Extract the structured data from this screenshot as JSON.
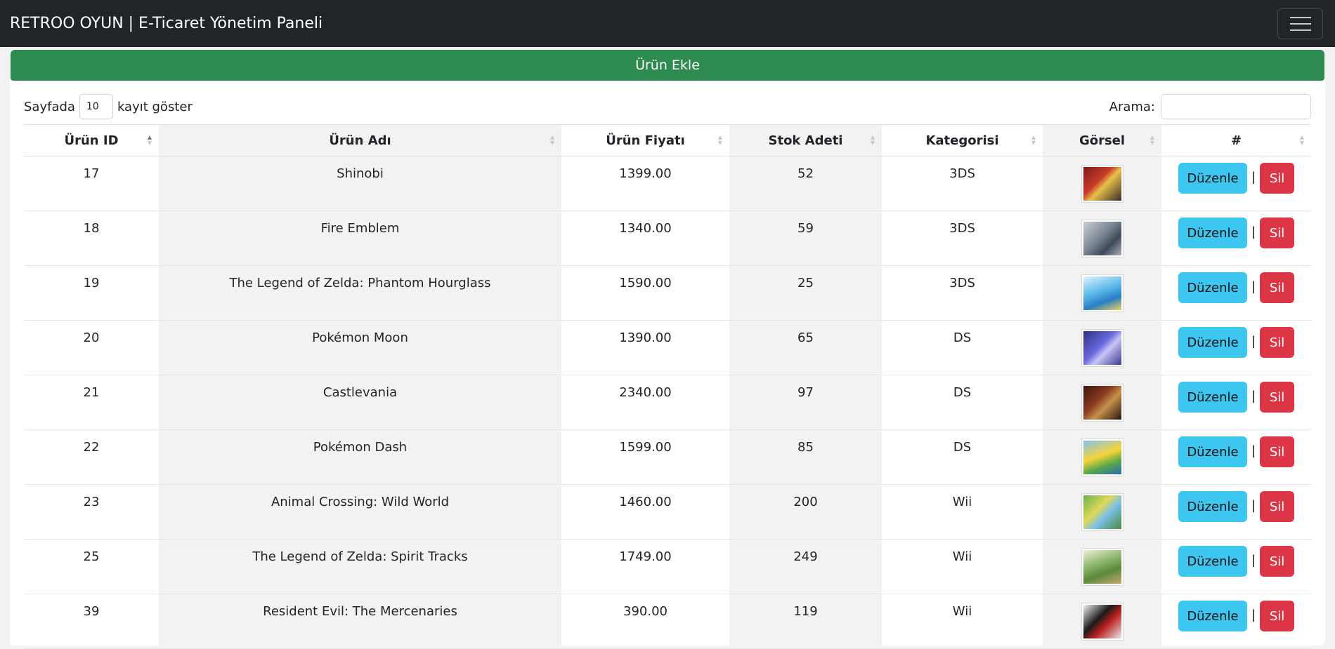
{
  "navbar": {
    "brand": "RETROO OYUN | E-Ticaret Yönetim Paneli",
    "toggle_icon": "hamburger-menu-icon"
  },
  "actions": {
    "add_label": "Ürün Ekle"
  },
  "length": {
    "prefix": "Sayfada",
    "value": "10",
    "suffix": "kayıt göster"
  },
  "search": {
    "label": "Arama:",
    "value": ""
  },
  "table": {
    "headers": [
      "Ürün ID",
      "Ürün Adı",
      "Ürün Fiyatı",
      "Stok Adeti",
      "Kategorisi",
      "Görsel",
      "#"
    ],
    "edit_label": "Düzenle",
    "delete_label": "Sil",
    "separator": "|",
    "rows": [
      {
        "id": "17",
        "name": "Shinobi",
        "price": "1399.00",
        "stock": "52",
        "category": "3DS"
      },
      {
        "id": "18",
        "name": "Fire Emblem",
        "price": "1340.00",
        "stock": "59",
        "category": "3DS"
      },
      {
        "id": "19",
        "name": "The Legend of Zelda: Phantom Hourglass",
        "price": "1590.00",
        "stock": "25",
        "category": "3DS"
      },
      {
        "id": "20",
        "name": "Pokémon Moon",
        "price": "1390.00",
        "stock": "65",
        "category": "DS"
      },
      {
        "id": "21",
        "name": "Castlevania",
        "price": "2340.00",
        "stock": "97",
        "category": "DS"
      },
      {
        "id": "22",
        "name": "Pokémon Dash",
        "price": "1599.00",
        "stock": "85",
        "category": "DS"
      },
      {
        "id": "23",
        "name": "Animal Crossing: Wild World",
        "price": "1460.00",
        "stock": "200",
        "category": "Wii"
      },
      {
        "id": "25",
        "name": "The Legend of Zelda: Spirit Tracks",
        "price": "1749.00",
        "stock": "249",
        "category": "Wii"
      },
      {
        "id": "39",
        "name": "Resident Evil: The Mercenaries",
        "price": "390.00",
        "stock": "119",
        "category": "Wii"
      }
    ]
  },
  "colors": {
    "navbar": "#212529",
    "add": "#2e8b50",
    "edit": "#3dc7f0",
    "delete": "#dc3545"
  }
}
